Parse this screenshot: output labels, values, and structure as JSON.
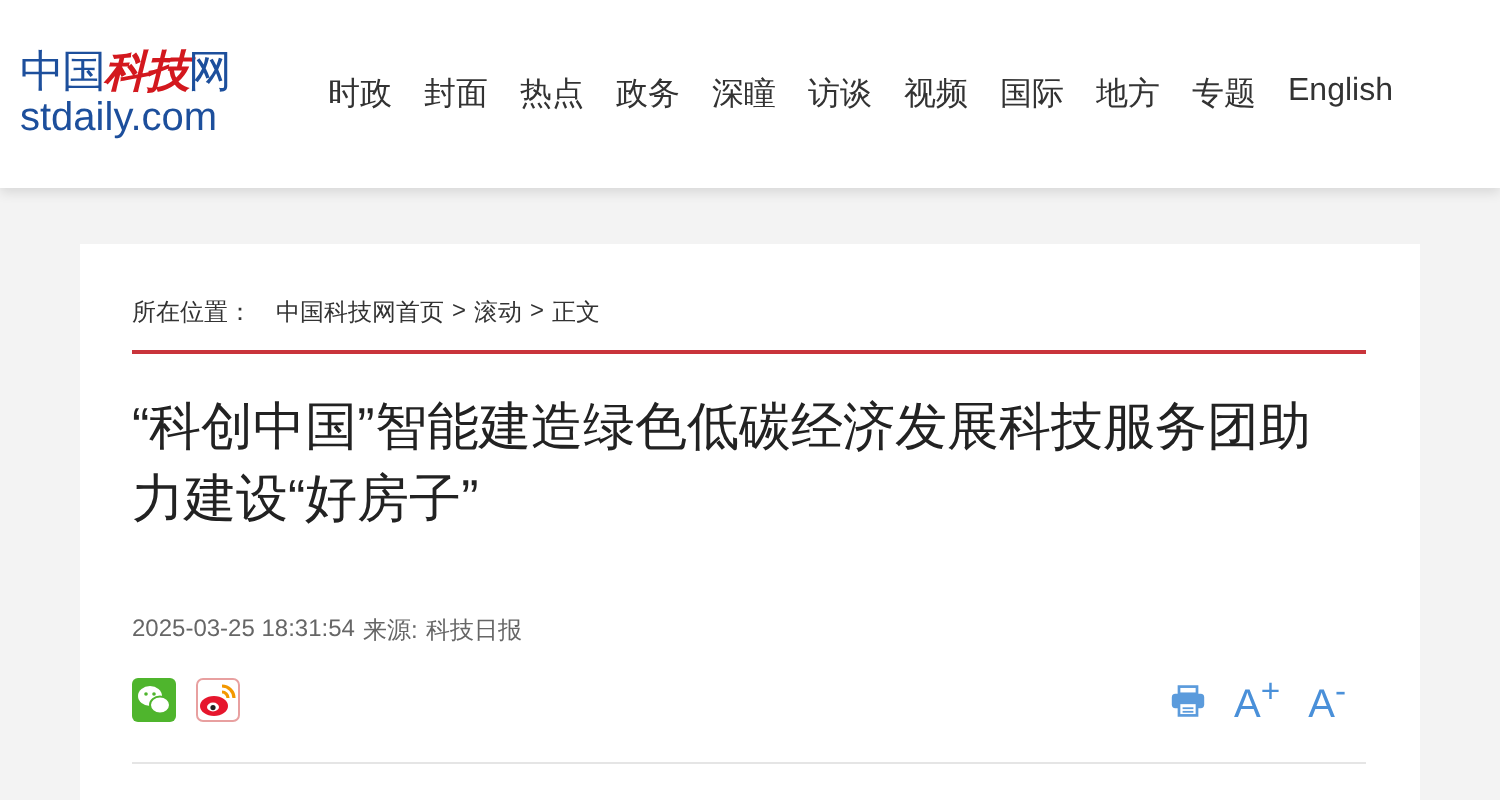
{
  "logo": {
    "cn_prefix": "中国",
    "cn_brand": "科技",
    "cn_suffix": "网",
    "domain": "stdaily.com"
  },
  "nav": [
    "时政",
    "封面",
    "热点",
    "政务",
    "深瞳",
    "访谈",
    "视频",
    "国际",
    "地方",
    "专题",
    "English"
  ],
  "breadcrumb": {
    "label": "所在位置：",
    "items": [
      "中国科技网首页",
      "滚动",
      "正文"
    ],
    "separator": ">"
  },
  "article": {
    "title": "“科创中国”智能建造绿色低碳经济发展科技服务团助力建设“好房子”",
    "datetime": "2025-03-25 18:31:54",
    "source_label": "来源:",
    "source": "科技日报"
  },
  "font_buttons": [
    "A$^{+}$",
    "A$^{-}$"
  ]
}
